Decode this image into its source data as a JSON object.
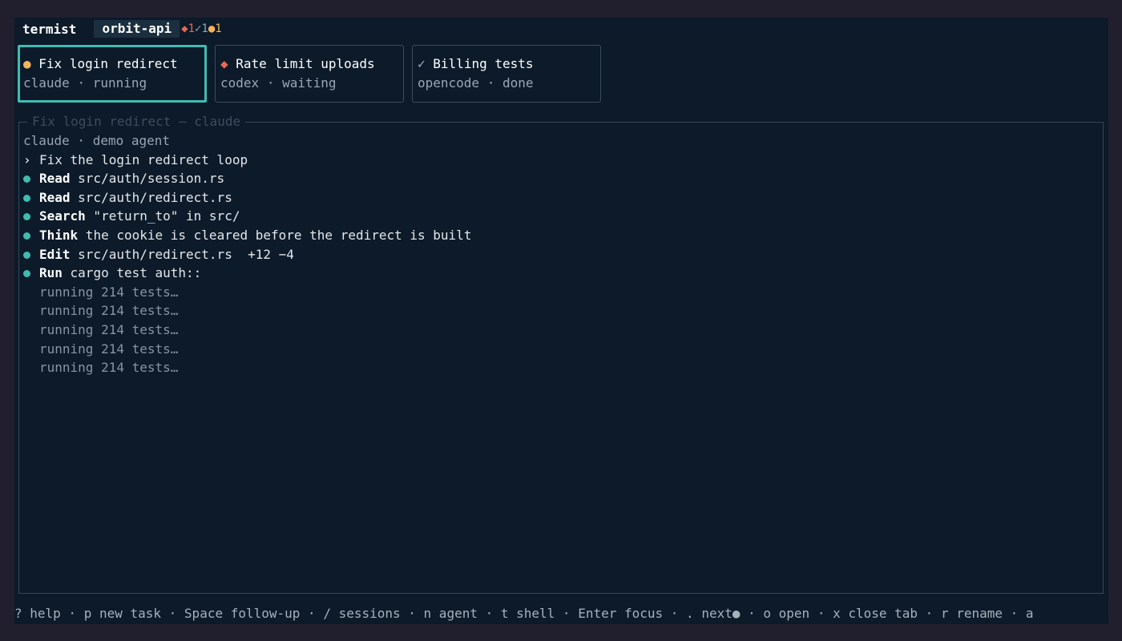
{
  "app": {
    "name": "termist",
    "project": "orbit-api"
  },
  "status_counts": {
    "waiting": "◆1",
    "done": "✓1",
    "running": "●1"
  },
  "colors": {
    "accent": "#3fbcb1",
    "running": "#f2b45a",
    "waiting": "#e5694f",
    "background": "#0c1a2a"
  },
  "tasks": [
    {
      "icon": "●",
      "title": "Fix login redirect",
      "agent": "claude",
      "status": "running"
    },
    {
      "icon": "◆",
      "title": "Rate limit uploads",
      "agent": "codex",
      "status": "waiting"
    },
    {
      "icon": "✓",
      "title": "Billing tests",
      "agent": "opencode",
      "status": "done"
    }
  ],
  "separator": "·",
  "panel": {
    "title": "Fix login redirect — claude",
    "subtitle": "claude · demo agent",
    "prompt_mark": "›",
    "prompt": "Fix the login redirect loop",
    "steps": [
      {
        "verb": "Read",
        "text": " src/auth/session.rs"
      },
      {
        "verb": "Read",
        "text": " src/auth/redirect.rs"
      },
      {
        "verb": "Search",
        "text": " \"return_to\" in src/"
      },
      {
        "verb": "Think",
        "text": " the cookie is cleared before the redirect is built"
      },
      {
        "verb": "Edit",
        "text": " src/auth/redirect.rs  +12 −4"
      },
      {
        "verb": "Run",
        "text": " cargo test auth::"
      }
    ],
    "output": [
      "running 214 tests…",
      "running 214 tests…",
      "running 214 tests…",
      "running 214 tests…",
      "running 214 tests…"
    ]
  },
  "footer": "? help · p new task · Space follow-up · / sessions · n agent · t shell · Enter focus · . next● · o open · x close tab · r rename · a"
}
